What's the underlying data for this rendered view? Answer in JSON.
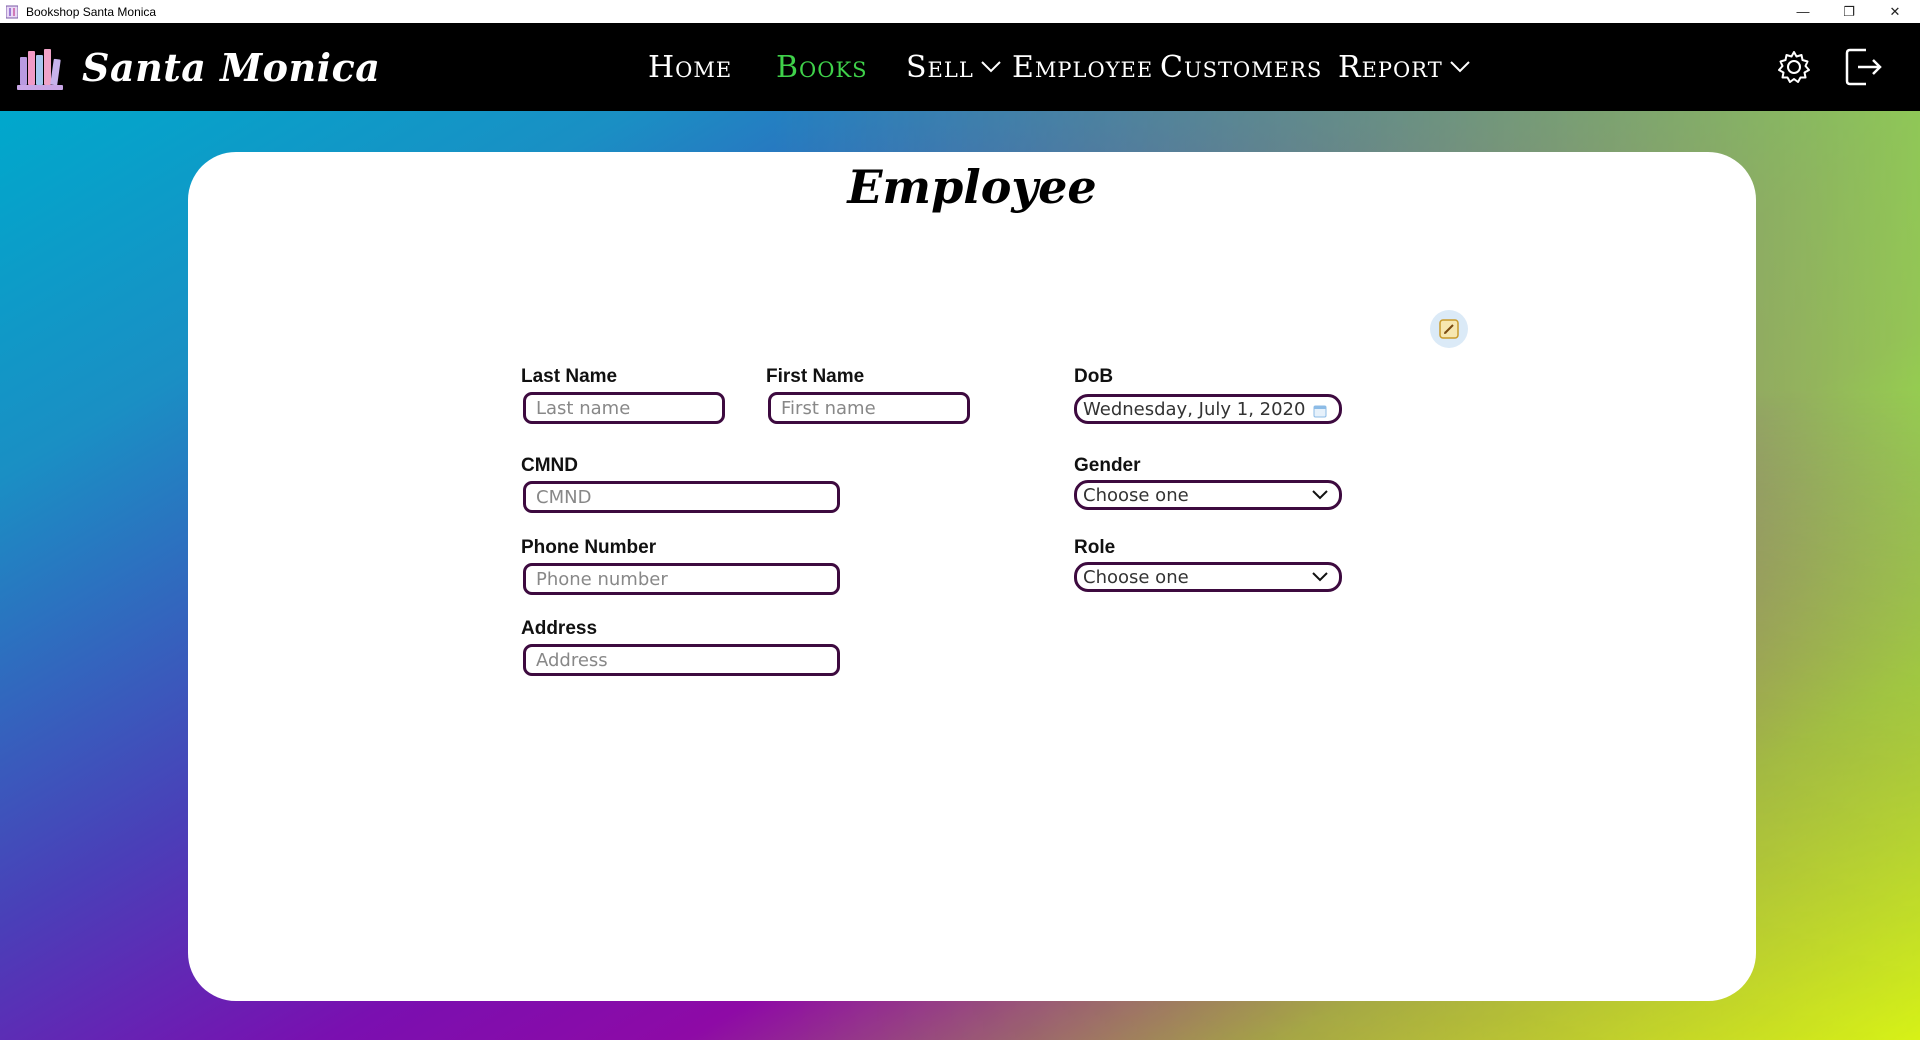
{
  "window": {
    "title": "Bookshop Santa Monica",
    "controls": [
      "—",
      "❐",
      "✕"
    ]
  },
  "navbar": {
    "brand": "Santa Monica",
    "items": [
      {
        "label": "Home"
      },
      {
        "label": "Books"
      },
      {
        "label": "Sell"
      },
      {
        "label": "Employee"
      },
      {
        "label": "Customers"
      },
      {
        "label": "Report"
      }
    ],
    "active_item": "Books",
    "active_color": "#3fd14a",
    "icons": [
      "gear-icon",
      "logout-icon"
    ]
  },
  "page": {
    "title": "Employee",
    "edit_icon": "edit-icon"
  },
  "form": {
    "last_name": {
      "label": "Last Name",
      "placeholder": "Last name"
    },
    "first_name": {
      "label": "First Name",
      "placeholder": "First name"
    },
    "dob": {
      "label": "DoB",
      "value": "Wednesday, July 1, 2020"
    },
    "cmnd": {
      "label": "CMND",
      "placeholder": "CMND"
    },
    "gender": {
      "label": "Gender",
      "value": "Choose one"
    },
    "phone": {
      "label": "Phone Number",
      "placeholder": "Phone number"
    },
    "role": {
      "label": "Role",
      "value": "Choose one"
    },
    "address": {
      "label": "Address",
      "placeholder": "Address"
    }
  },
  "colors": {
    "navbar_bg": "#000000",
    "field_border": "#3d0a3f",
    "card_bg": "#ffffff"
  }
}
